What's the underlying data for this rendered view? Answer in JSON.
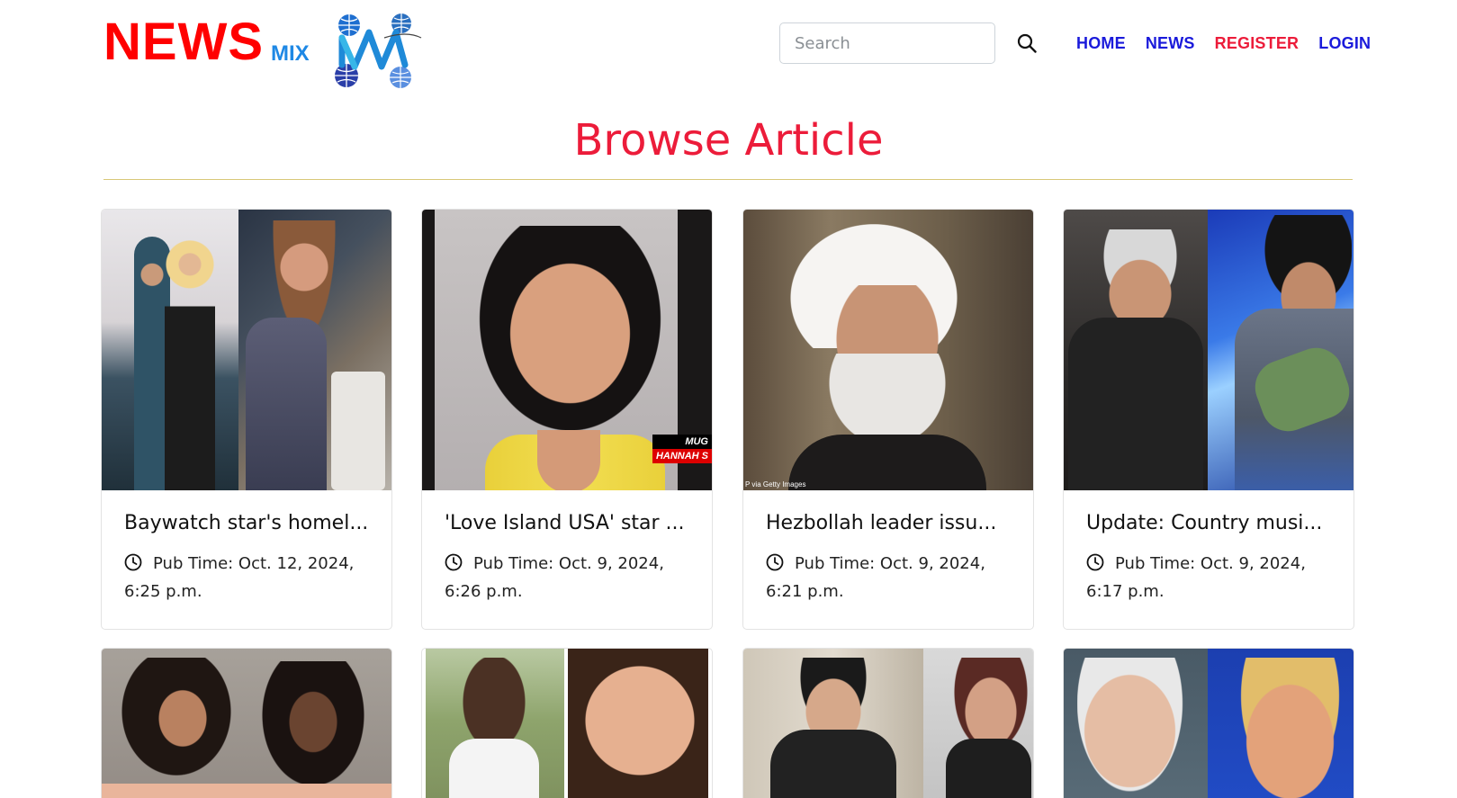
{
  "header": {
    "brand_news": "NEWS",
    "brand_mix": "MIX",
    "logo_icon": "globe-mw-logo",
    "search": {
      "placeholder": "Search"
    },
    "nav": [
      {
        "label": "HOME",
        "color": "#1a1adb"
      },
      {
        "label": "NEWS",
        "color": "#1a1adb"
      },
      {
        "label": "REGISTER",
        "color": "#ec1c3a"
      },
      {
        "label": "LOGIN",
        "color": "#1a1adb"
      }
    ]
  },
  "main": {
    "heading": "Browse Article",
    "articles": [
      {
        "title": "Baywatch star's homel...",
        "pub_label": "Pub Time: Oct. 12, 2024,",
        "pub_time": "6:25 p.m."
      },
      {
        "title": "'Love Island USA' star ...",
        "pub_label": "Pub Time: Oct. 9, 2024,",
        "pub_time": "6:26 p.m.",
        "image_tag_1": "MUG",
        "image_tag_2": "HANNAH S"
      },
      {
        "title": "Hezbollah leader issu...",
        "pub_label": "Pub Time: Oct. 9, 2024,",
        "pub_time": "6:21 p.m.",
        "image_credit": "P via Getty Images"
      },
      {
        "title": "Update: Country musi...",
        "pub_label": "Pub Time: Oct. 9, 2024,",
        "pub_time": "6:17 p.m."
      }
    ]
  },
  "colors": {
    "brand_red": "#ff0000",
    "brand_blue": "#1e88e5",
    "heading_red": "#ec1c3a",
    "divider": "#d8c878"
  }
}
